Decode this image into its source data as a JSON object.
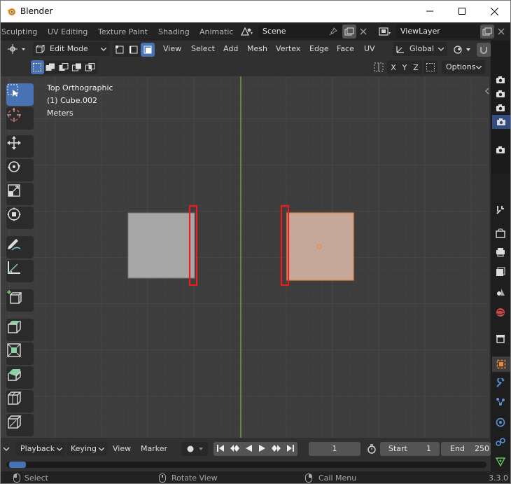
{
  "window": {
    "title": "Blender"
  },
  "workspace_tabs": [
    "Sculpting",
    "UV Editing",
    "Texture Paint",
    "Shading",
    "Animatic"
  ],
  "scene": {
    "name": "Scene"
  },
  "view_layer": {
    "name": "ViewLayer"
  },
  "header": {
    "mode": "Edit Mode",
    "menus": [
      "View",
      "Select",
      "Add",
      "Mesh",
      "Vertex",
      "Edge",
      "Face",
      "UV"
    ],
    "transform_orientation": "Global"
  },
  "toolrow": {
    "axes": [
      "X",
      "Y",
      "Z"
    ],
    "options_label": "Options"
  },
  "viewport": {
    "view_name": "Top Orthographic",
    "object_info": "(1) Cube.002",
    "units": "Meters"
  },
  "timeline": {
    "menus": [
      "Playback",
      "Keying",
      "View",
      "Marker"
    ],
    "current_frame": "1",
    "start_label": "Start",
    "start_value": "1",
    "end_label": "End",
    "end_value": "250"
  },
  "statusbar": {
    "select": "Select",
    "rotate_view": "Rotate View",
    "call_menu": "Call Menu",
    "version": "3.3.0"
  },
  "colors": {
    "active_blue": "#4772b3",
    "selected_orange": "#e8883a",
    "highlight_red": "#ee1c1c"
  }
}
